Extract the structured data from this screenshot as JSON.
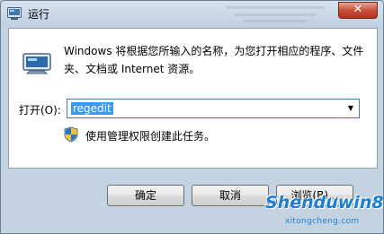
{
  "window": {
    "title": "运行",
    "close_glyph": "✕"
  },
  "dialog": {
    "description": "Windows 将根据您所输入的名称，为您打开相应的程序、文件夹、文档或 Internet 资源。",
    "open_label": "打开(O):",
    "open_value": "regedit",
    "admin_note": "使用管理权限创建此任务。"
  },
  "buttons": {
    "ok": "确定",
    "cancel": "取消",
    "browse": "浏览(B)..."
  },
  "watermark": {
    "main": "Shenduwin8.com",
    "sub": "xitongcheng.com"
  },
  "colors": {
    "selection": "#3399ff",
    "close_button": "#c9503a",
    "watermark": "#1a7fd4"
  }
}
